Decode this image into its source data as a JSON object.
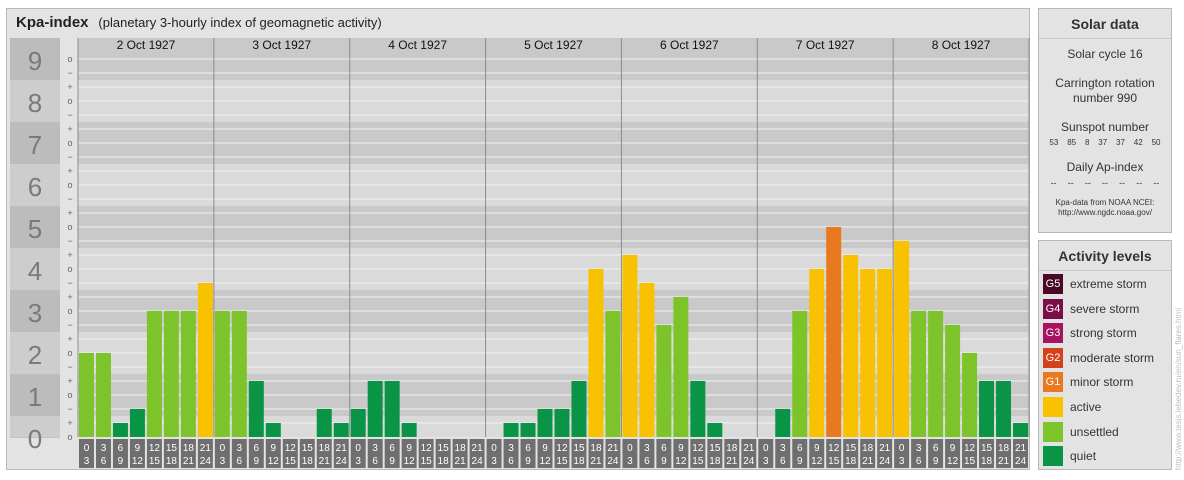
{
  "title": "Kpa-index",
  "subtitle": "(planetary 3-hourly index of geomagnetic activity)",
  "chart_data": {
    "type": "bar",
    "title": "Kpa-index",
    "subtitle": "(planetary 3-hourly index of geomagnetic activity)",
    "ylim": [
      0,
      9
    ],
    "y_ticks": [
      "0",
      "1",
      "2",
      "3",
      "4",
      "5",
      "6",
      "7",
      "8",
      "9"
    ],
    "sub_ticks": [
      "o",
      "+",
      "−",
      "o"
    ],
    "days": [
      "2 Oct 1927",
      "3 Oct 1927",
      "4 Oct 1927",
      "5 Oct 1927",
      "6 Oct 1927",
      "7 Oct 1927",
      "8 Oct 1927"
    ],
    "interval_start": [
      "0",
      "3",
      "6",
      "9",
      "12",
      "15",
      "18",
      "21"
    ],
    "interval_end": [
      "3",
      "6",
      "9",
      "12",
      "15",
      "18",
      "21",
      "24"
    ],
    "values": [
      2.0,
      2.0,
      0.333,
      0.667,
      3.0,
      3.0,
      3.0,
      3.667,
      3.0,
      3.0,
      1.333,
      0.333,
      0,
      0,
      0.667,
      0.333,
      0.667,
      1.333,
      1.333,
      0.333,
      0,
      0,
      0,
      0,
      0,
      0.333,
      0.333,
      0.667,
      0.667,
      1.333,
      4.0,
      3.0,
      4.333,
      3.667,
      2.667,
      3.333,
      1.333,
      0.333,
      0,
      0,
      0,
      0.667,
      3.0,
      4.0,
      5.0,
      4.333,
      4.0,
      4.0,
      4.667,
      3.0,
      3.0,
      2.667,
      2.0,
      1.333,
      1.333,
      0.333
    ]
  },
  "solar": {
    "heading": "Solar data",
    "cycle": "Solar cycle 16",
    "carrington_line1": "Carrington rotation",
    "carrington_line2": "number 990",
    "sunspot_label": "Sunspot number",
    "sunspots": [
      "53",
      "85",
      "8",
      "37",
      "37",
      "42",
      "50"
    ],
    "ap_label": "Daily Ap-index",
    "ap_values": [
      "--",
      "--",
      "--",
      "--",
      "--",
      "--",
      "--"
    ],
    "source_line1": "Kpa-data from NOAA NCEI:",
    "source_line2": "http://www.ngdc.noaa.gov/"
  },
  "levels": {
    "heading": "Activity levels",
    "items": [
      {
        "badge": "G5",
        "label": "extreme storm",
        "color": "#4a0a25"
      },
      {
        "badge": "G4",
        "label": "severe storm",
        "color": "#7a0e47"
      },
      {
        "badge": "G3",
        "label": "strong storm",
        "color": "#a8125f"
      },
      {
        "badge": "G2",
        "label": "moderate storm",
        "color": "#d4421c"
      },
      {
        "badge": "G1",
        "label": "minor storm",
        "color": "#e8791f"
      },
      {
        "badge": "",
        "label": "active",
        "color": "#f8c200"
      },
      {
        "badge": "",
        "label": "unsettled",
        "color": "#7dc42a"
      },
      {
        "badge": "",
        "label": "quiet",
        "color": "#0a9446"
      }
    ]
  },
  "credit": "http://www.tesis.lebedev.ru/en/sun_flares.html"
}
